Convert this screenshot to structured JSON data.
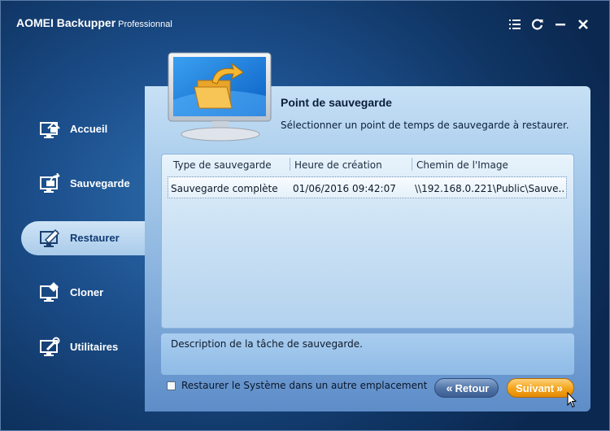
{
  "window": {
    "app_name": "AOMEI Backupper",
    "edition": "Professionnal"
  },
  "title_controls": [
    "menu-icon",
    "refresh-icon",
    "minimize-icon",
    "close-icon"
  ],
  "sidebar": {
    "items": [
      {
        "label": "Accueil",
        "icon": "home-monitor-icon",
        "active": false
      },
      {
        "label": "Sauvegarde",
        "icon": "backup-monitor-icon",
        "active": false
      },
      {
        "label": "Restaurer",
        "icon": "restore-monitor-icon",
        "active": true
      },
      {
        "label": "Cloner",
        "icon": "clone-monitor-icon",
        "active": false
      },
      {
        "label": "Utilitaires",
        "icon": "tools-monitor-icon",
        "active": false
      }
    ]
  },
  "panel": {
    "title": "Point de sauvegarde",
    "subtitle": "Sélectionner un point de temps de sauvegarde à restaurer.",
    "illustration": "restore-monitor-folder-icon"
  },
  "table": {
    "columns": [
      "Type de sauvegarde",
      "Heure de création",
      "Chemin de l'Image"
    ],
    "rows": [
      [
        "Sauvegarde complète",
        "01/06/2016 09:42:07",
        "\\\\192.168.0.221\\Public\\Sauve..."
      ]
    ]
  },
  "description": "Description de la tâche de sauvegarde.",
  "options": {
    "restore_elsewhere_label": "Restaurer le Système dans un autre emplacement",
    "restore_elsewhere_checked": false
  },
  "buttons": {
    "back_label": "Retour",
    "next_label": "Suivant"
  },
  "colors": {
    "accent_orange": "#f3a31a",
    "panel_blue": "#aacdec",
    "background_blue": "#1c4f8c"
  }
}
